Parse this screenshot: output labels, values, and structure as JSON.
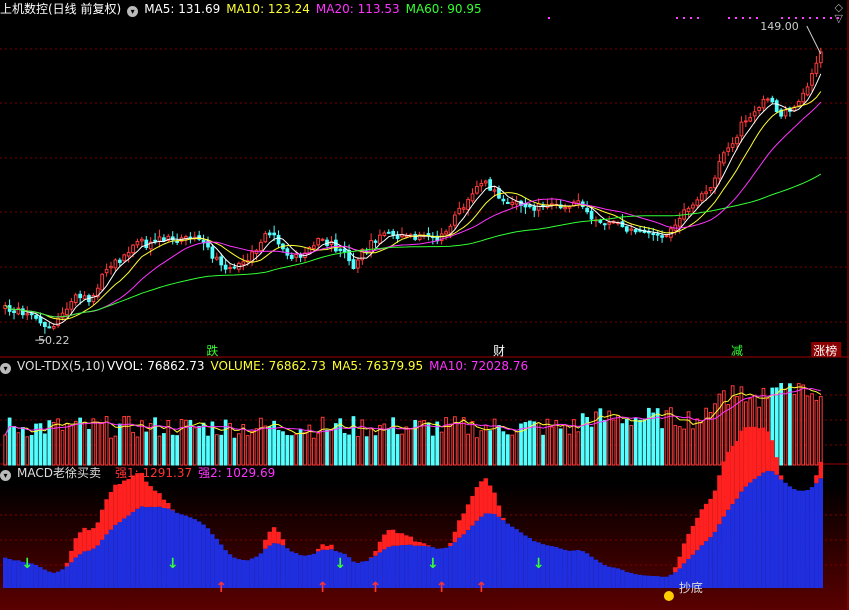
{
  "main_panel": {
    "stock_name": "上机数控(日线 前复权)",
    "ma_labels": [
      {
        "text": "MA5: 131.69",
        "color": "#ffffff"
      },
      {
        "text": "MA10: 123.24",
        "color": "#ffff33"
      },
      {
        "text": "MA20: 113.53",
        "color": "#ff33ff"
      },
      {
        "text": "MA60: 90.95",
        "color": "#33ff33"
      }
    ],
    "high_label": "149.00",
    "low_label": "50.22",
    "event_markers": [
      {
        "text": "跌",
        "index": 47,
        "color": "#33ff33"
      },
      {
        "text": "财",
        "index": 112,
        "color": "#ffffff"
      },
      {
        "text": "减",
        "index": 166,
        "color": "#33ff33"
      },
      {
        "text": "涨榜",
        "index": 186,
        "color": "#ffffff",
        "bg": "#8b0000"
      }
    ]
  },
  "volume_panel": {
    "title": "VOL-TDX(5,10)",
    "labels": [
      {
        "text": "VVOL: 76862.73",
        "color": "#ffffff"
      },
      {
        "text": "VOLUME: 76862.73",
        "color": "#ffff33"
      },
      {
        "text": "MA5: 76379.95",
        "color": "#ffff33"
      },
      {
        "text": "MA10: 72028.76",
        "color": "#ff33ff"
      }
    ]
  },
  "macd_panel": {
    "title": "MACD老徐买卖",
    "labels": [
      {
        "text": "强1: 1291.37",
        "color": "#ff3333"
      },
      {
        "text": "强2: 1029.69",
        "color": "#ff33ff"
      }
    ],
    "bottom_label": "抄底"
  },
  "colors": {
    "up": "#ff3b3b",
    "down": "#54ffff",
    "ma5": "#ffffff",
    "ma10": "#ffff33",
    "ma20": "#ff33ff",
    "ma60": "#33ff33",
    "grid": "#7a0000",
    "blue_bar": "#1f2fe0"
  },
  "chart_data": {
    "type": "candlestick",
    "price_range": [
      45,
      155
    ],
    "price_series": [
      60.3,
      58.4,
      58.0,
      59.5,
      57.3,
      57.6,
      57.5,
      56.1,
      54.6,
      53.4,
      53.1,
      53.4,
      56.1,
      57.8,
      59.1,
      61.6,
      63.8,
      62.9,
      63.5,
      61.6,
      63.6,
      66.0,
      70.6,
      72.2,
      73.2,
      75.3,
      74.5,
      77.0,
      77.8,
      80.2,
      81.4,
      82.1,
      79.4,
      81.2,
      81.6,
      82.9,
      81.7,
      83.1,
      82.0,
      81.1,
      82.6,
      83.0,
      82.8,
      82.8,
      82.1,
      80.9,
      79.6,
      75.9,
      76.2,
      73.7,
      72.3,
      72.8,
      72.7,
      74.2,
      74.7,
      75.1,
      78.0,
      78.5,
      81.1,
      84.0,
      83.6,
      83.6,
      80.6,
      79.0,
      76.9,
      75.8,
      77.1,
      76.2,
      77.6,
      79.4,
      80.0,
      82.4,
      82.1,
      80.1,
      81.4,
      78.3,
      78.4,
      78.0,
      75.1,
      72.5,
      75.3,
      78.8,
      77.9,
      81.7,
      81.1,
      83.5,
      84.2,
      84.4,
      83.6,
      82.4,
      83.7,
      83.2,
      83.6,
      82.1,
      83.6,
      83.4,
      83.1,
      82.7,
      81.6,
      83.9,
      84.6,
      86.4,
      90.1,
      92.3,
      92.5,
      95.2,
      97.1,
      99.5,
      100.5,
      101.3,
      98.3,
      98.4,
      95.7,
      94.8,
      94.1,
      94.3,
      94.6,
      93.3,
      92.8,
      93.2,
      91.7,
      93.8,
      92.9,
      93.4,
      93.8,
      93.6,
      92.5,
      92.6,
      92.8,
      94.4,
      94.8,
      92.9,
      91.2,
      88.8,
      88.5,
      87.7,
      87.1,
      87.6,
      88.1,
      87.6,
      86.3,
      84.8,
      85.5,
      84.6,
      84.8,
      84.4,
      84.3,
      84.0,
      83.8,
      82.8,
      83.3,
      85.6,
      86.8,
      89.0,
      91.8,
      92.3,
      93.4,
      95.1,
      97.1,
      97.7,
      99.1,
      102.3,
      107.7,
      110.6,
      112.2,
      113.6,
      115.7,
      120.7,
      121.1,
      122.2,
      124.1,
      125.5,
      128.2,
      128.3,
      127.4,
      124.2,
      122.7,
      124.7,
      124.3,
      125.7,
      127.5,
      130.2,
      132.3,
      136.7,
      140.1,
      143.8
    ],
    "ma_last": {
      "MA5": 131.69,
      "MA10": 123.24,
      "MA20": 113.53,
      "MA60": 90.95
    },
    "high": 149.0,
    "low": 50.22,
    "volume_range": [
      0,
      100000
    ],
    "volume_last": 76862.73,
    "volume_ma_last": {
      "MA5": 76379.95,
      "MA10": 72028.76
    },
    "macd_last": {
      "强1": 1291.37,
      "强2": 1029.69
    },
    "buy_arrow_indices": [
      49,
      72,
      84,
      99,
      108
    ],
    "sell_arrow_indices": [
      5,
      38,
      76,
      97,
      121
    ]
  }
}
